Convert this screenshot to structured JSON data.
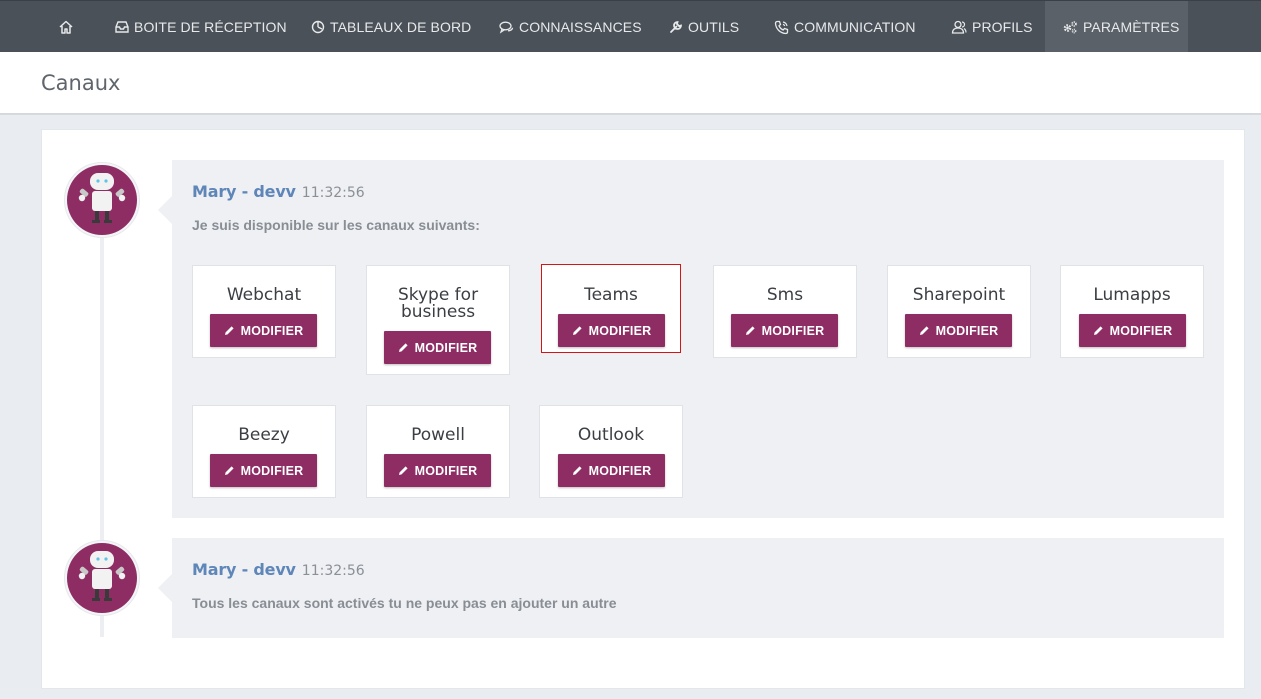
{
  "nav": {
    "home_icon": "home-icon",
    "items": [
      {
        "label": "BOITE DE RÉCEPTION",
        "icon": "inbox-icon"
      },
      {
        "label": "TABLEAUX DE BORD",
        "icon": "dashboard-icon"
      },
      {
        "label": "CONNAISSANCES",
        "icon": "chat-icon"
      },
      {
        "label": "OUTILS",
        "icon": "wrench-icon"
      },
      {
        "label": "COMMUNICATION",
        "icon": "phone-icon"
      },
      {
        "label": "PROFILS",
        "icon": "users-icon"
      },
      {
        "label": "PARAMÈTRES",
        "icon": "gears-icon"
      }
    ],
    "active": "PARAMÈTRES"
  },
  "page": {
    "title": "Canaux"
  },
  "messages": [
    {
      "author": "Mary - devv",
      "time": "11:32:56",
      "text": "Je suis disponible sur les canaux suivants:",
      "avatar_icon": "robot-icon"
    },
    {
      "author": "Mary - devv",
      "time": "11:32:56",
      "text": "Tous les canaux sont activés tu ne peux pas en ajouter un autre",
      "avatar_icon": "robot-icon"
    }
  ],
  "channels": [
    {
      "name": "Webchat",
      "button": "MODIFIER"
    },
    {
      "name": "Skype for business",
      "button": "MODIFIER"
    },
    {
      "name": "Teams",
      "button": "MODIFIER",
      "highlighted": true
    },
    {
      "name": "Sms",
      "button": "MODIFIER"
    },
    {
      "name": "Sharepoint",
      "button": "MODIFIER"
    },
    {
      "name": "Lumapps",
      "button": "MODIFIER"
    },
    {
      "name": "Beezy",
      "button": "MODIFIER"
    },
    {
      "name": "Powell",
      "button": "MODIFIER"
    },
    {
      "name": "Outlook",
      "button": "MODIFIER"
    }
  ],
  "colors": {
    "nav_bg": "#4a5158",
    "accent": "#8d2d64",
    "author": "#5e86b8",
    "highlight": "#d01616"
  }
}
